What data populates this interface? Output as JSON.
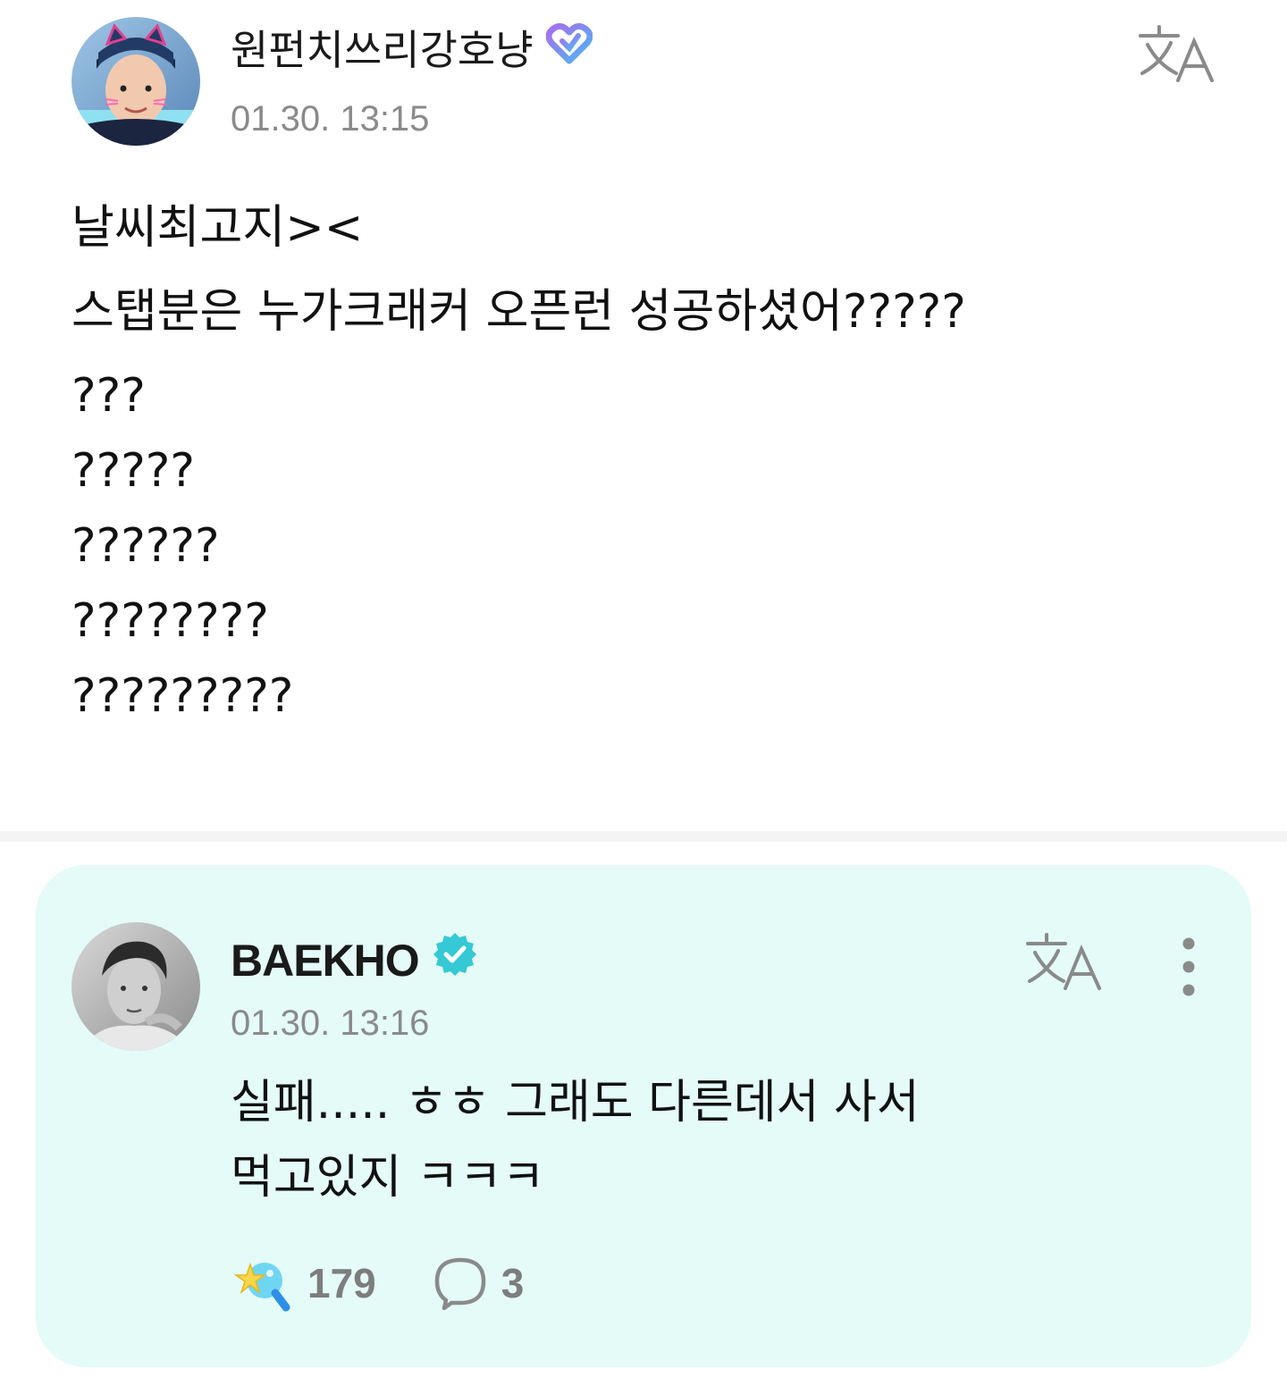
{
  "post": {
    "author": {
      "name": "원펀치쓰리강호냥",
      "avatar_icon": "cat-ear-fan-avatar",
      "badge_icon": "heart-badge-icon"
    },
    "timestamp": "01.30. 13:15",
    "translate_icon": "translate-icon",
    "lines": [
      "날씨최고지><",
      "스탭분은 누가크래커 오픈런 성공하셨어?????",
      "???",
      "?????",
      "??????",
      "????????",
      "?????????"
    ]
  },
  "reply": {
    "author": {
      "name": "BAEKHO",
      "avatar_icon": "artist-avatar",
      "badge_icon": "verified-badge-icon"
    },
    "timestamp": "01.30. 13:16",
    "translate_icon": "translate-icon",
    "more_icon": "more-vertical-icon",
    "lines": [
      "실패..... ㅎㅎ 그래도 다른데서 사서",
      "먹고있지 ㅋㅋㅋ"
    ],
    "reactions": {
      "like_icon": "star-lightstick-icon",
      "like_count": "179",
      "comment_icon": "comment-bubble-icon",
      "comment_count": "3"
    }
  },
  "colors": {
    "reply_background": "#e4fbf8",
    "verified": "#35c9d5",
    "heart_badge": "#6f8cf5",
    "muted_text": "#8a8a8a"
  }
}
